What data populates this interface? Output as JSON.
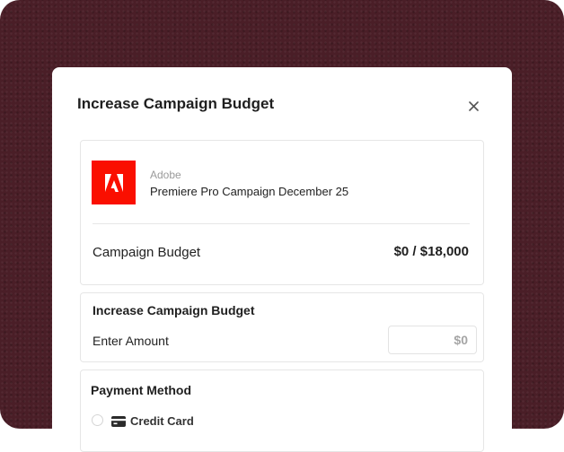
{
  "modal": {
    "title": "Increase Campaign Budget",
    "close_icon": "close-icon"
  },
  "campaign": {
    "logo_icon": "adobe-logo-icon",
    "brand": "Adobe",
    "name": "Premiere Pro Campaign December 25",
    "budget_label": "Campaign Budget",
    "budget_value": "$0 / $18,000"
  },
  "increase": {
    "title": "Increase Campaign Budget",
    "amount_label": "Enter Amount",
    "amount_value": "",
    "amount_placeholder": "$0"
  },
  "payment": {
    "title": "Payment Method",
    "options": [
      {
        "label": "Credit Card",
        "icon": "credit-card-icon",
        "selected": false
      }
    ]
  },
  "colors": {
    "backdrop": "#4a1e27",
    "brand_red": "#fa0f00"
  }
}
